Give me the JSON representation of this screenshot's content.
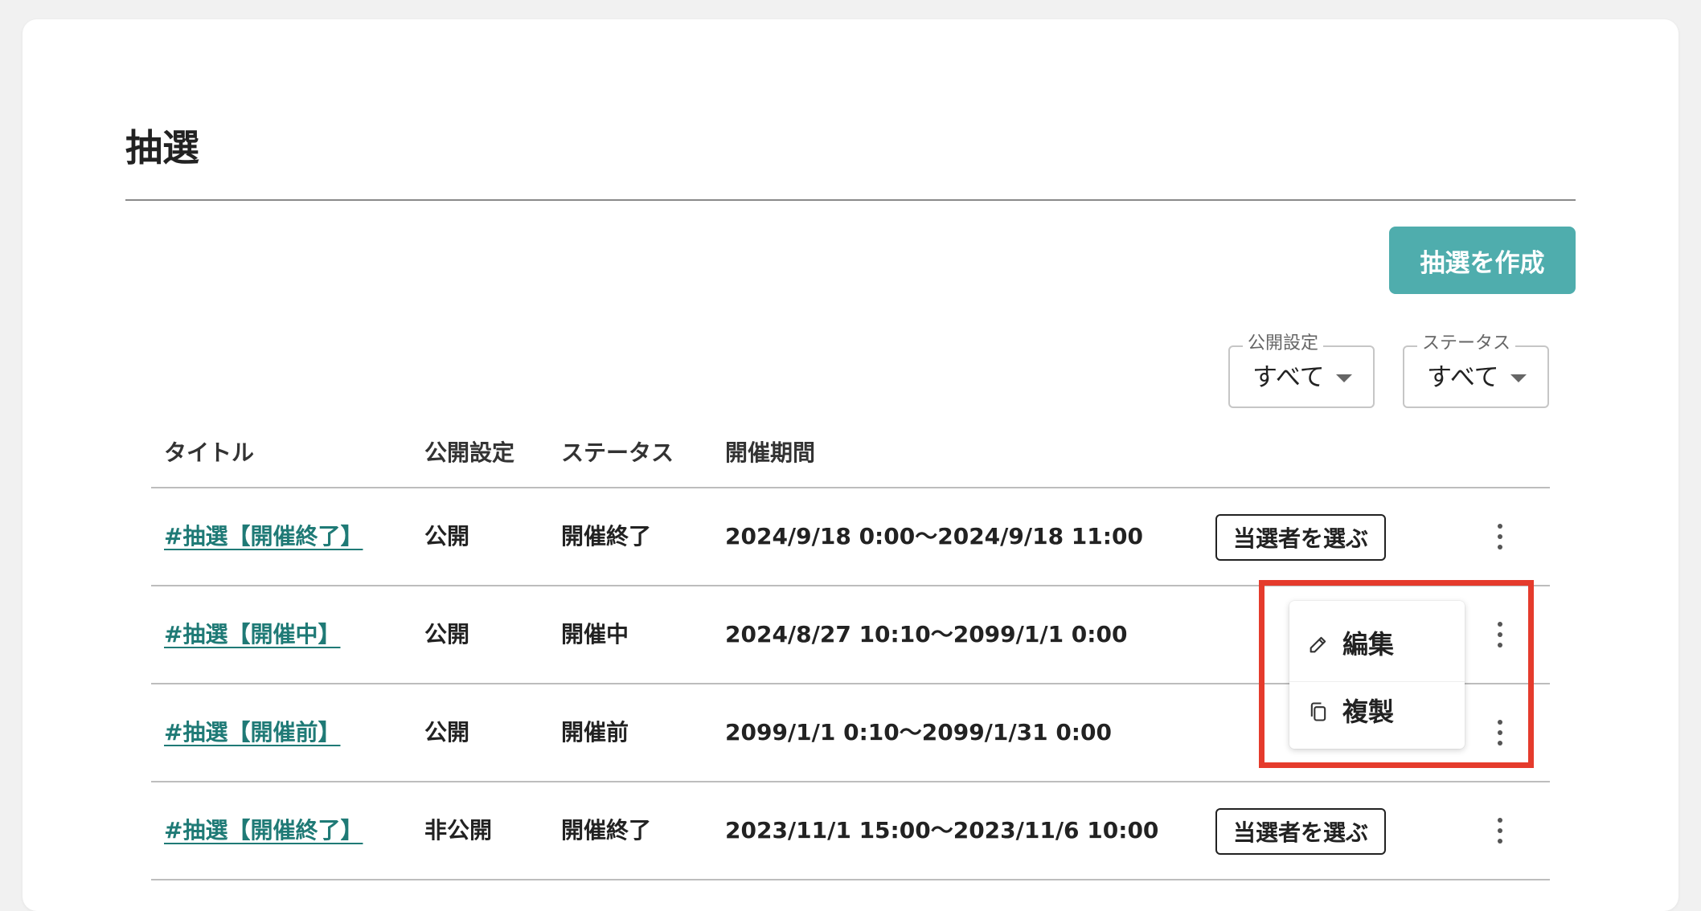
{
  "page": {
    "title": "抽選"
  },
  "toolbar": {
    "create_label": "抽選を作成"
  },
  "filters": [
    {
      "label": "公開設定",
      "value": "すべて"
    },
    {
      "label": "ステータス",
      "value": "すべて"
    }
  ],
  "table": {
    "headers": [
      "タイトル",
      "公開設定",
      "ステータス",
      "開催期間"
    ],
    "rows": [
      {
        "title": "#抽選【開催終了】",
        "visibility": "公開",
        "status": "開催終了",
        "period": "2024/9/18 0:00〜2024/9/18 11:00",
        "action_label": "当選者を選ぶ"
      },
      {
        "title": "#抽選【開催中】",
        "visibility": "公開",
        "status": "開催中",
        "period": "2024/8/27 10:10〜2099/1/1 0:00",
        "action_label": ""
      },
      {
        "title": "#抽選【開催前】",
        "visibility": "公開",
        "status": "開催前",
        "period": "2099/1/1 0:10〜2099/1/31 0:00",
        "action_label": ""
      },
      {
        "title": "#抽選【開催終了】",
        "visibility": "非公開",
        "status": "開催終了",
        "period": "2023/11/1 15:00〜2023/11/6 10:00",
        "action_label": "当選者を選ぶ"
      }
    ]
  },
  "context_menu": {
    "items": [
      {
        "label": "編集",
        "icon": "edit-icon"
      },
      {
        "label": "複製",
        "icon": "copy-icon"
      }
    ]
  },
  "colors": {
    "accent": "#4fadad",
    "link": "#1f7a76",
    "highlight": "#e53b2c"
  }
}
